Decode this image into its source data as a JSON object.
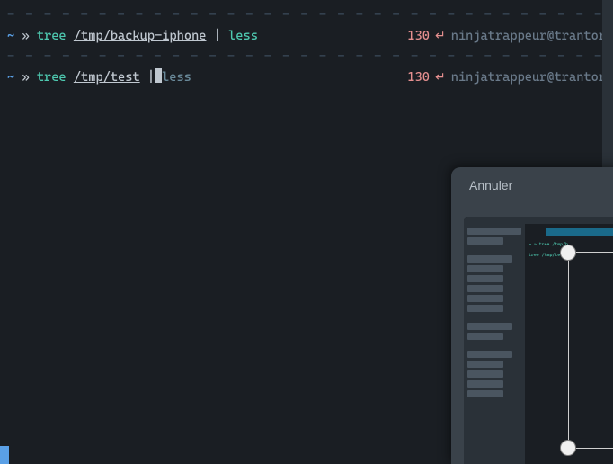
{
  "terminal": {
    "lines": [
      {
        "tilde": "~",
        "arrow": "»",
        "cmd": "tree",
        "path": "/tmp/backup-iphone",
        "pipe": "|",
        "pager": "less",
        "exit_code": "130",
        "return": "↵",
        "userhost": "ninjatrappeur@trantor"
      },
      {
        "tilde": "~",
        "arrow": "»",
        "cmd": "tree",
        "path": "/tmp/test",
        "pipe": "|",
        "pager": "less",
        "exit_code": "130",
        "return": "↵",
        "userhost": "ninjatrappeur@trantor"
      }
    ],
    "separator": "- - - - - - - - - - - - - - - - - - - - - - - - - - - - - - - - - - - - - - - - - - - -"
  },
  "popup": {
    "cancel_label": "Annuler"
  }
}
